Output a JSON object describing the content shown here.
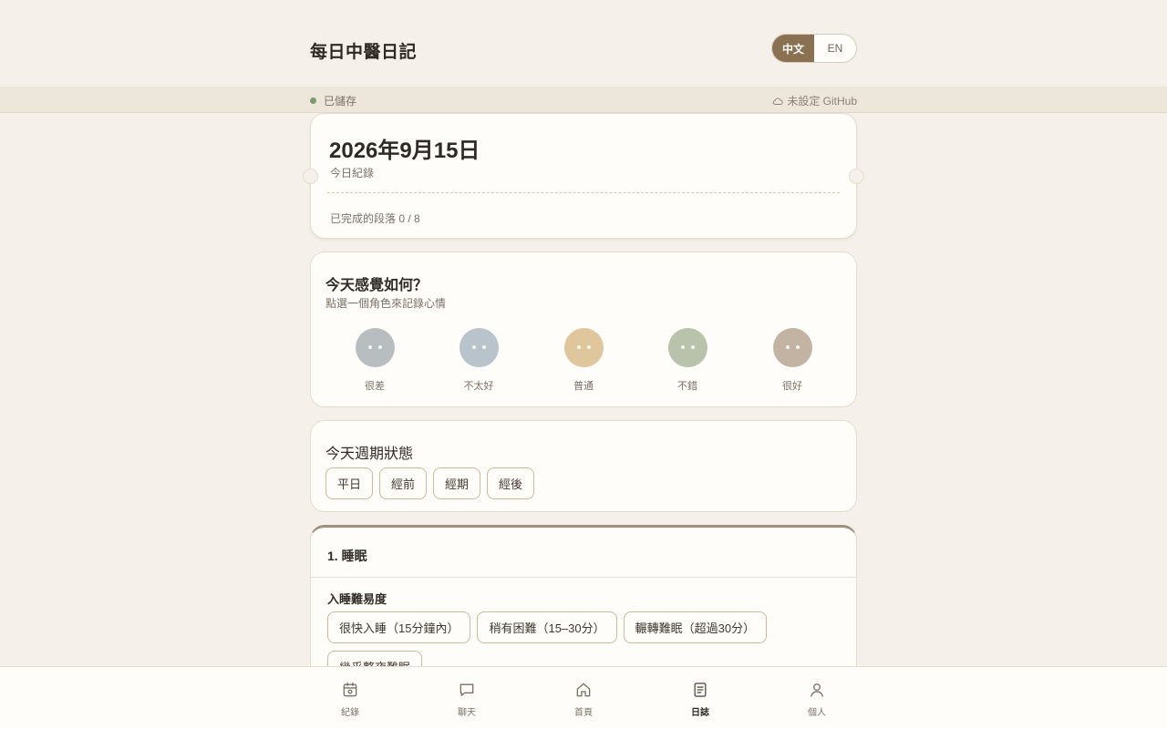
{
  "header": {
    "title": "每日中醫日記",
    "lang_options": [
      {
        "label": "中文",
        "active": true
      },
      {
        "label": "EN",
        "active": false
      }
    ]
  },
  "status": {
    "saved_text": "已儲存",
    "saved_color": "#7e9a6c",
    "github_text": "未設定 GitHub"
  },
  "date_card": {
    "date": "2026年9月15日",
    "subtitle": "今日紀錄",
    "progress": "已完成的段落 0 / 8"
  },
  "mood": {
    "title": "今天感覺如何？",
    "subtitle": "點選一個角色來記錄心情",
    "options": [
      {
        "label": "很差",
        "color": "#b8bdbf"
      },
      {
        "label": "不太好",
        "color": "#b8c3cb"
      },
      {
        "label": "普通",
        "color": "#dfc69c"
      },
      {
        "label": "不錯",
        "color": "#b9c2aa"
      },
      {
        "label": "很好",
        "color": "#c3b3a3"
      }
    ]
  },
  "cycle": {
    "title": "今天週期狀態",
    "options": [
      "平日",
      "經前",
      "經期",
      "經後"
    ]
  },
  "sleep": {
    "section_title": "1. 睡眠",
    "question": "入睡難易度",
    "options": [
      "很快入睡（15分鐘內）",
      "稍有困難（15–30分）",
      "輾轉難眠（超過30分）",
      "幾乎整夜難眠"
    ]
  },
  "nav": {
    "items": [
      {
        "label": "紀錄",
        "icon": "calendar-icon",
        "active": false
      },
      {
        "label": "聊天",
        "icon": "chat-icon",
        "active": false
      },
      {
        "label": "首頁",
        "icon": "home-icon",
        "active": false
      },
      {
        "label": "日誌",
        "icon": "journal-icon",
        "active": true
      },
      {
        "label": "個人",
        "icon": "user-icon",
        "active": false
      }
    ]
  },
  "colors": {
    "accent": "#8a7152",
    "background": "#f5f0e9",
    "card": "#fffdfa",
    "chip_border": "#cdb89a"
  }
}
